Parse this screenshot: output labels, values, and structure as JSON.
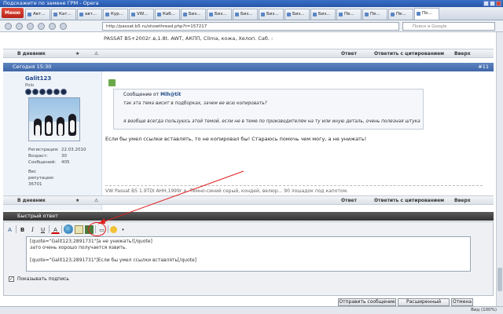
{
  "window": {
    "title": "Подскажите по замене ГРМ - Opera"
  },
  "browser": {
    "menu_label": "Меню",
    "tabs": [
      {
        "label": "Авт..."
      },
      {
        "label": "Кат..."
      },
      {
        "label": "авт..."
      },
      {
        "label": "Кур..."
      },
      {
        "label": "VW..."
      },
      {
        "label": "Каб..."
      },
      {
        "label": "Биз..."
      },
      {
        "label": "Биз..."
      },
      {
        "label": "Биз..."
      },
      {
        "label": "Биз..."
      },
      {
        "label": "Биз..."
      },
      {
        "label": "Биз..."
      },
      {
        "label": "Пе..."
      },
      {
        "label": "Пе..."
      },
      {
        "label": "Пе..."
      },
      {
        "label": "По..."
      }
    ],
    "url": "http://passat.b5.ru/showthread.php?t=157217",
    "search_placeholder": "Поиск в Google",
    "zoom": "Вид (100%)"
  },
  "prev_post": {
    "signature": "PASSAT B5+2002г.в,1.8t. AWT, АКПП, Clima, кожа, Хелоп. Саб. :",
    "footer": {
      "diary": "В дневник",
      "reply": "Ответ",
      "reply_quote": "Ответить с цитированием",
      "up": "Вверх"
    }
  },
  "post": {
    "date": "Сегодня 15:30",
    "number": "#11",
    "user": {
      "name": "Galit123",
      "title": "Polo",
      "stats": [
        {
          "k": "Регистрация:",
          "v": "22.03.2010"
        },
        {
          "k": "Возраст:",
          "v": "30"
        },
        {
          "k": "Сообщений:",
          "v": "405"
        },
        {
          "k": "Вес",
          "v": ""
        },
        {
          "k": "репутации:",
          "v": ""
        },
        {
          "k": "36701",
          "v": ""
        }
      ]
    },
    "quote": {
      "header_prefix": "Сообщение от",
      "author": "Mih@tit",
      "line1": "так эта тема висит в подборках, зачем ее всю копировать?",
      "line2": "я вообще всегда пользуюсь этой темой, если не в теме по производителям на ту или иную деталь, очень полезная штука"
    },
    "text": "Если бы умел ссылки вставлять, то не копировал бы! Стараюсь помочь чем могу, а не унижать!",
    "signature": "VW Passat B5 1.9TDI AHH,1999г.в. Темно-синий серый, кондей, велюр... 90 лошадок под капотом.",
    "footer": {
      "diary": "В дневник",
      "reply": "Ответ",
      "reply_quote": "Ответить с цитированием",
      "up": "Вверх"
    }
  },
  "quick_reply": {
    "title": "Быстрый ответ",
    "toolbar": {
      "a": "A",
      "bold": "B",
      "italic": "I",
      "underline": "U",
      "color": "A"
    },
    "lines": [
      "[quote=\"Galit123;2891731\"]а не унижать![/quote]",
      "зато очень хорошо получается язвить.",
      "",
      "[quote=\"Galit123;2891731\"]Если бы умел ссылки вставлять[/quote]"
    ],
    "show_signature": "Показывать подпись",
    "buttons": {
      "submit": "Отправить сообщение",
      "advanced": "Расширенный режим",
      "cancel": "Отмена"
    }
  },
  "colors": {
    "accent": "#3f66a8",
    "header_dark": "#333333",
    "annotation": "#e02020"
  }
}
